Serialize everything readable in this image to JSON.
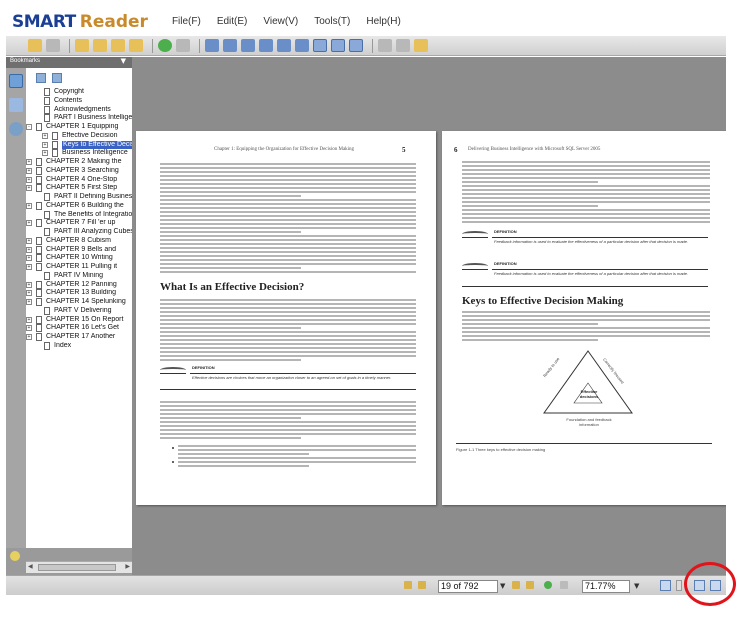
{
  "app": {
    "logo_smart": "SMART",
    "logo_reader": "Reader"
  },
  "menu": {
    "items": [
      "File(F)",
      "Edit(E)",
      "View(V)",
      "Tools(T)",
      "Help(H)"
    ]
  },
  "sidebar": {
    "header": "Bookmarks",
    "items": [
      {
        "label": "Copyright",
        "level": 1,
        "expand": ""
      },
      {
        "label": "Contents",
        "level": 1,
        "expand": ""
      },
      {
        "label": "Acknowledgments",
        "level": 1,
        "expand": ""
      },
      {
        "label": "PART I Business Intelligence",
        "level": 1,
        "expand": ""
      },
      {
        "label": "CHAPTER 1 Equipping",
        "level": 0,
        "expand": "-"
      },
      {
        "label": "Effective Decision",
        "level": 2,
        "expand": "+"
      },
      {
        "label": "Keys to Effective Decision",
        "level": 2,
        "expand": "+",
        "selected": true
      },
      {
        "label": "Business Intelligence",
        "level": 2,
        "expand": "+"
      },
      {
        "label": "CHAPTER 2 Making the",
        "level": 0,
        "expand": "+"
      },
      {
        "label": "CHAPTER 3 Searching",
        "level": 0,
        "expand": "+"
      },
      {
        "label": "CHAPTER 4 One-Stop",
        "level": 0,
        "expand": "+"
      },
      {
        "label": "CHAPTER 5 First Step",
        "level": 0,
        "expand": "+"
      },
      {
        "label": "PART II Defining Business",
        "level": 1,
        "expand": ""
      },
      {
        "label": "CHAPTER 6 Building the",
        "level": 0,
        "expand": "+"
      },
      {
        "label": "The Benefits of Integration",
        "level": 1,
        "expand": ""
      },
      {
        "label": "CHAPTER 7 Fill 'er up",
        "level": 0,
        "expand": "+"
      },
      {
        "label": "PART III Analyzing Cubes",
        "level": 1,
        "expand": ""
      },
      {
        "label": "CHAPTER 8 Cubism",
        "level": 0,
        "expand": "+"
      },
      {
        "label": "CHAPTER 9 Bells and",
        "level": 0,
        "expand": "+"
      },
      {
        "label": "CHAPTER 10 Writing",
        "level": 0,
        "expand": "+"
      },
      {
        "label": "CHAPTER 11 Pulling it",
        "level": 0,
        "expand": "+"
      },
      {
        "label": "PART IV Mining",
        "level": 1,
        "expand": ""
      },
      {
        "label": "CHAPTER 12 Panning",
        "level": 0,
        "expand": "+"
      },
      {
        "label": "CHAPTER 13 Building",
        "level": 0,
        "expand": "+"
      },
      {
        "label": "CHAPTER 14 Spelunking",
        "level": 0,
        "expand": "+"
      },
      {
        "label": "PART V Delivering",
        "level": 1,
        "expand": ""
      },
      {
        "label": "CHAPTER 15 On Report",
        "level": 0,
        "expand": "+"
      },
      {
        "label": "CHAPTER 16 Let's Get",
        "level": 0,
        "expand": "+"
      },
      {
        "label": "CHAPTER 17 Another",
        "level": 0,
        "expand": "+"
      },
      {
        "label": "Index",
        "level": 1,
        "expand": ""
      }
    ]
  },
  "document": {
    "left_page": {
      "header": "Chapter 1: Equipping the Organization for Effective Decision Making",
      "page_number": "5",
      "heading": "What Is an Effective Decision?",
      "definition_label": "DEFINITION",
      "definition_text": "Effective decisions are choices that move an organization closer to an agreed-on set of goals in a timely manner."
    },
    "right_page": {
      "header": "Delivering Business Intelligence with Microsoft SQL Server 2005",
      "page_number": "6",
      "definition_label_1": "DEFINITION",
      "definition_text_1": "Feedback information is used to evaluate the effectiveness of a particular decision after that decision is made.",
      "definition_label_2": "DEFINITION",
      "definition_text_2": "Feedback information is used to evaluate the effectiveness of a particular decision after that decision is made.",
      "heading": "Keys to Effective Decision Making",
      "figure_caption": "Figure 1-1   Three keys to effective decision making",
      "triangle_center": "Effective decisions",
      "triangle_left": "Ready to use",
      "triangle_right": "Correctly focused",
      "triangle_base": "Foundation and feedback information"
    }
  },
  "status": {
    "page_indicator": "19 of 792",
    "zoom": "71.77%"
  },
  "colors": {
    "highlight": "#e0141a",
    "selected_bookmark": "#3a62c4",
    "logo_blue": "#1b3f94",
    "logo_gold": "#c88a2a"
  }
}
